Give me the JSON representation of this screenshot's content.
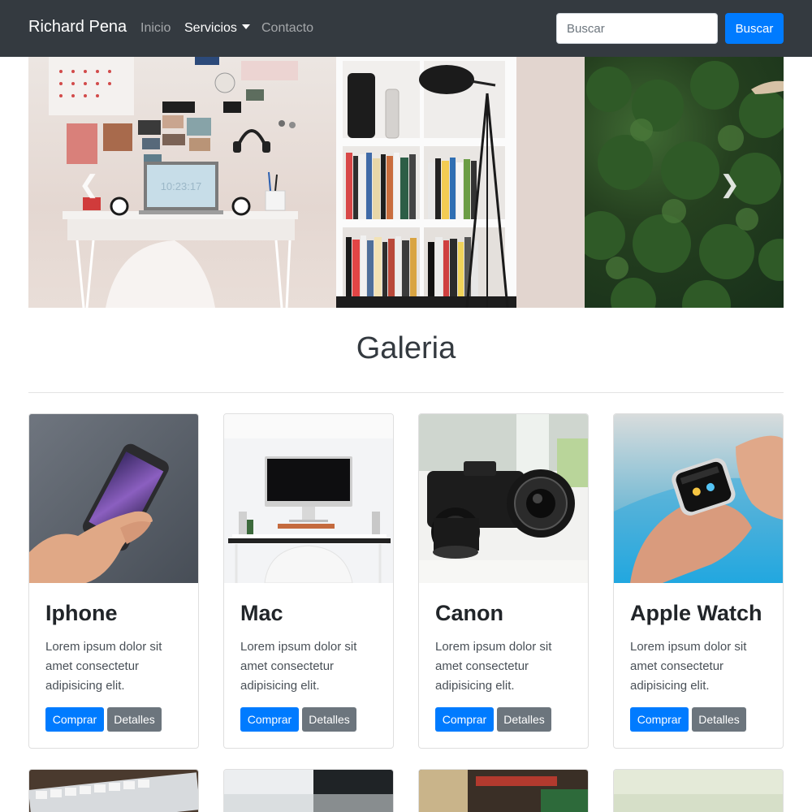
{
  "navbar": {
    "brand": "Richard Pena",
    "links": [
      {
        "label": "Inicio"
      },
      {
        "label": "Servicios"
      },
      {
        "label": "Contacto"
      }
    ],
    "search": {
      "placeholder": "Buscar",
      "button_label": "Buscar"
    }
  },
  "carousel": {
    "prev_icon": "chevron-left-icon",
    "next_icon": "chevron-right-icon"
  },
  "gallery": {
    "title": "Galeria",
    "cards": [
      {
        "title": "Iphone",
        "text": "Lorem ipsum dolor sit amet consectetur adipisicing elit.",
        "buy_label": "Comprar",
        "details_label": "Detalles"
      },
      {
        "title": "Mac",
        "text": "Lorem ipsum dolor sit amet consectetur adipisicing elit.",
        "buy_label": "Comprar",
        "details_label": "Detalles"
      },
      {
        "title": "Canon",
        "text": "Lorem ipsum dolor sit amet consectetur adipisicing elit.",
        "buy_label": "Comprar",
        "details_label": "Detalles"
      },
      {
        "title": "Apple Watch",
        "text": "Lorem ipsum dolor sit amet consectetur adipisicing elit.",
        "buy_label": "Comprar",
        "details_label": "Detalles"
      }
    ]
  },
  "colors": {
    "navbar_bg": "#343a40",
    "primary": "#007bff",
    "secondary": "#6c757d"
  }
}
